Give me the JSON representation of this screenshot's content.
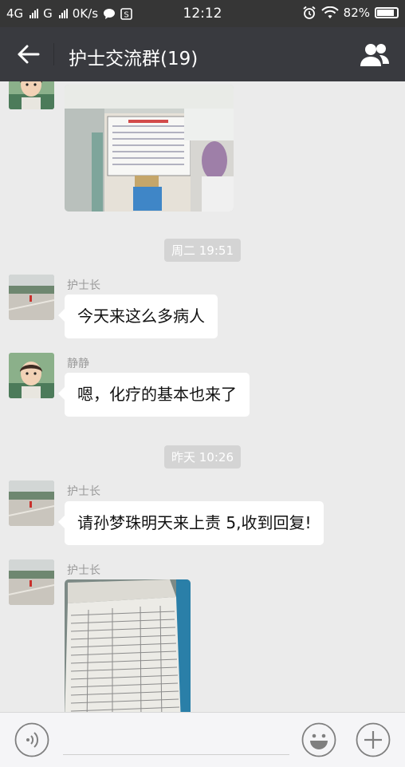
{
  "status_bar": {
    "network1": "4G",
    "network2": "G",
    "speed": "0K/s",
    "time": "12:12",
    "battery": "82%"
  },
  "header": {
    "title": "护士交流群(19)"
  },
  "messages": {
    "timestamp1": "周二 19:51",
    "m2": {
      "sender": "护士长",
      "text": "今天来这么多病人"
    },
    "m3": {
      "sender": "静静",
      "text": "嗯，化疗的基本也来了"
    },
    "timestamp2": "昨天 10:26",
    "m4": {
      "sender": "护士长",
      "text": "请孙梦珠明天来上责 5,收到回复!"
    },
    "m5": {
      "sender": "护士长"
    }
  },
  "icons": {
    "back": "arrow-left-icon",
    "members": "group-members-icon",
    "voice": "voice-icon",
    "emoji": "emoji-icon",
    "more": "plus-icon"
  }
}
